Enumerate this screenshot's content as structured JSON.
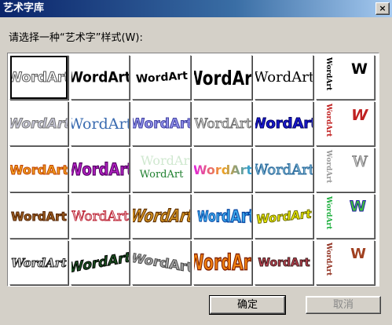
{
  "window": {
    "title": "艺术字库",
    "close_glyph": "×"
  },
  "prompt": "请选择一种“艺术字”样式(W):",
  "gallery": {
    "sample_text": "WordArt",
    "vertical_text": "WordArt",
    "letter_w": "W"
  },
  "buttons": {
    "ok": "确定",
    "cancel": "取消"
  }
}
